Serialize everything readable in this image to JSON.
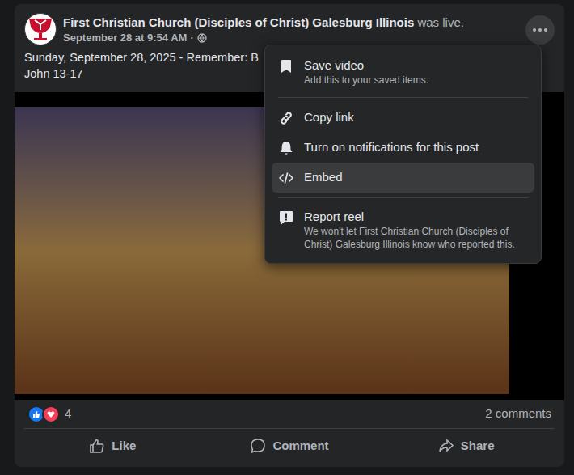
{
  "post": {
    "page_name": "First Christian Church (Disciples of Christ) Galesburg Illinois",
    "action": "was live.",
    "timestamp": "September 28 at 9:54 AM",
    "separator": "·",
    "caption_lines": [
      "Sunday, September 28, 2025 - Remember: B",
      "John 13-17"
    ],
    "reaction_count": "4",
    "comments": "2 comments"
  },
  "actions": [
    {
      "label": "Like"
    },
    {
      "label": "Comment"
    },
    {
      "label": "Share"
    }
  ],
  "menu": {
    "sections": [
      [
        {
          "label": "Save video",
          "subtitle": "Add this to your saved items.",
          "highlighted": false
        }
      ],
      [
        {
          "label": "Copy link",
          "highlighted": false
        },
        {
          "label": "Turn on notifications for this post",
          "highlighted": false
        },
        {
          "label": "Embed",
          "highlighted": true
        }
      ],
      [
        {
          "label": "Report reel",
          "subtitle": "We won't let First Christian Church (Disciples of Christ) Galesburg Illinois know who reported this.",
          "highlighted": false
        }
      ]
    ]
  }
}
